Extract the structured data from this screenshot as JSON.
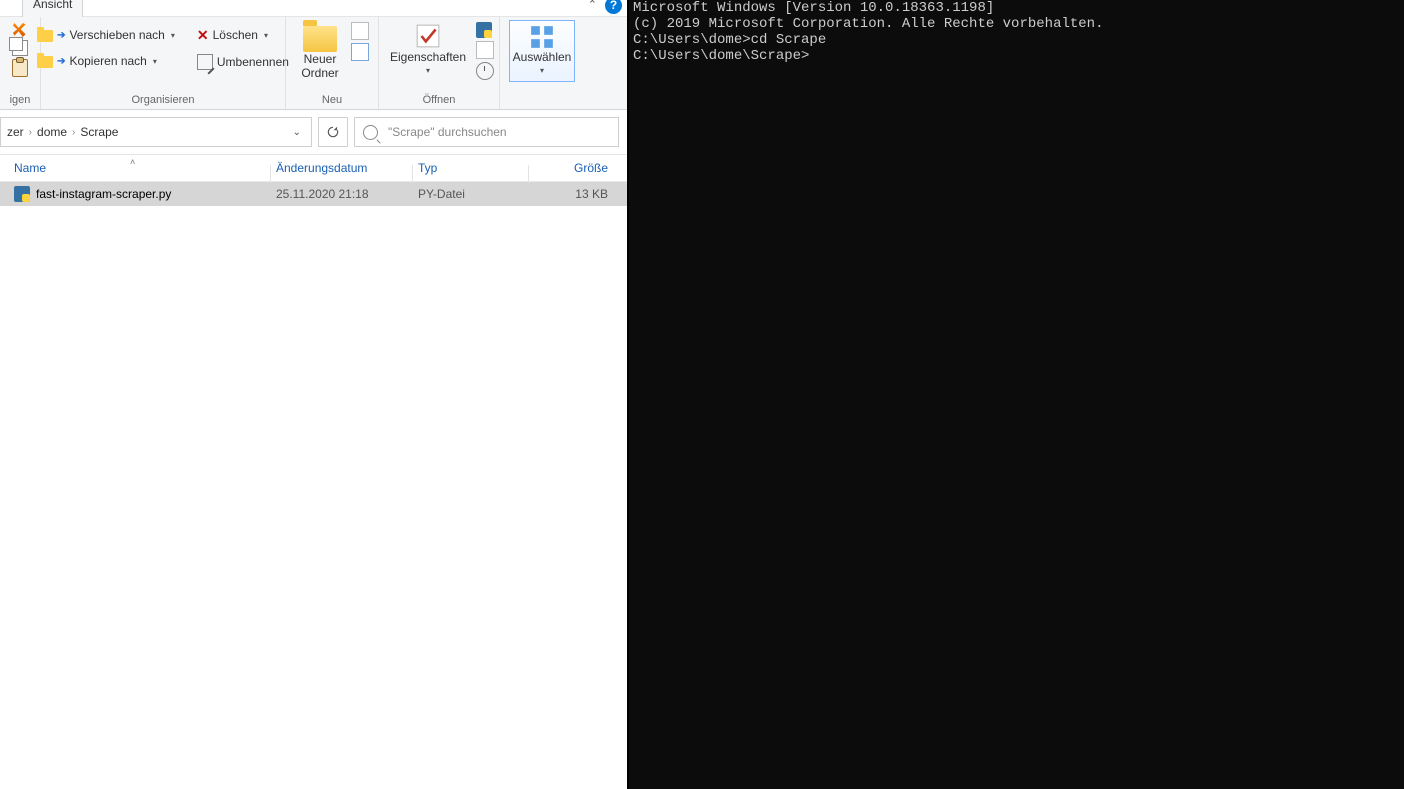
{
  "explorer": {
    "active_tab": "Ansicht",
    "ribbon": {
      "clipboard": {
        "cut_suffix": "igen"
      },
      "organize": {
        "move_to": "Verschieben nach",
        "copy_to": "Kopieren nach",
        "delete": "Löschen",
        "rename": "Umbenennen",
        "group": "Organisieren"
      },
      "new": {
        "new_folder_line1": "Neuer",
        "new_folder_line2": "Ordner",
        "group": "Neu"
      },
      "open": {
        "properties": "Eigenschaften",
        "group": "Öffnen"
      },
      "select": {
        "select_label": "Auswählen",
        "group": ""
      }
    },
    "breadcrumbs": {
      "p0": "zer",
      "p1": "dome",
      "p2": "Scrape"
    },
    "search_placeholder": "\"Scrape\" durchsuchen",
    "columns": {
      "name": "Name",
      "date": "Änderungsdatum",
      "type": "Typ",
      "size": "Größe"
    },
    "rows": [
      {
        "name": "fast-instagram-scraper.py",
        "date": "25.11.2020 21:18",
        "type": "PY-Datei",
        "size": "13 KB"
      }
    ]
  },
  "terminal": {
    "l0": "Microsoft Windows [Version 10.0.18363.1198]",
    "l1": "(c) 2019 Microsoft Corporation. Alle Rechte vorbehalten.",
    "l2": "",
    "l3": "C:\\Users\\dome>cd Scrape",
    "l4": "",
    "l5": "C:\\Users\\dome\\Scrape>"
  }
}
